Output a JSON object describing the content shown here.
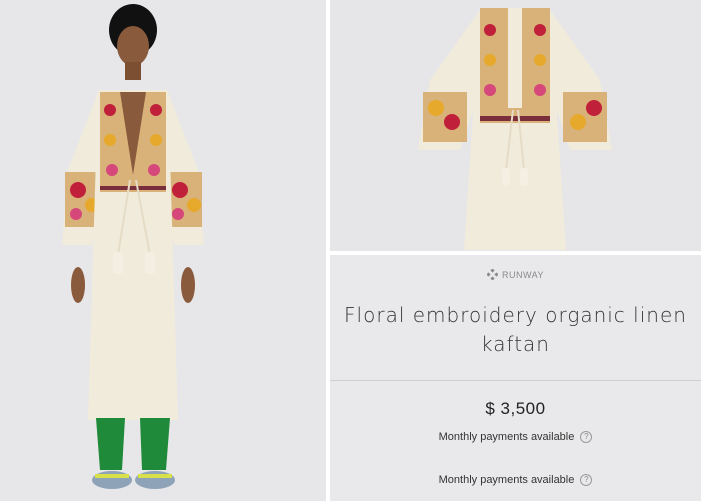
{
  "brand": {
    "name": "RUNWAY",
    "icon": "diamond-grid-icon"
  },
  "product": {
    "title": "Floral embroidery organic linen kaftan",
    "price": "$ 3,500",
    "payments": [
      {
        "label": "Monthly payments available",
        "icon": "question-circle-icon"
      },
      {
        "label": "Monthly payments available",
        "icon": "question-circle-icon"
      }
    ]
  },
  "colors": {
    "linen": "#f1ebdc",
    "pants_green": "#1f8a3a",
    "embroidery_red": "#c0203a",
    "embroidery_yellow": "#e7a92b",
    "background": "#e7e7e9"
  }
}
